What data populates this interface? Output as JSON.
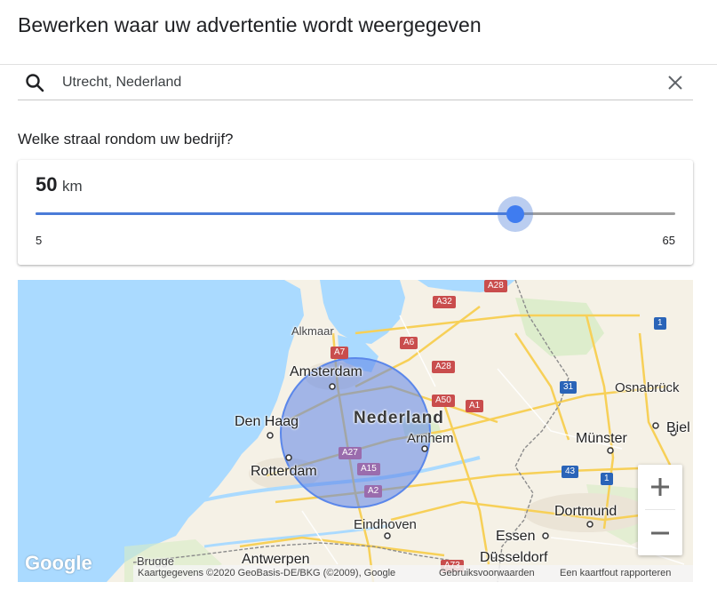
{
  "title": "Bewerken waar uw advertentie wordt weergegeven",
  "search": {
    "value": "Utrecht, Nederland"
  },
  "radius": {
    "question": "Welke straal rondom uw bedrijf?",
    "value": "50",
    "unit": "km",
    "min": "5",
    "max": "65",
    "current": 50,
    "min_value": 5,
    "max_value": 65
  },
  "colors": {
    "accent": "#4a7bd8",
    "water": "#aadaff",
    "land": "#f5f1e6",
    "radius_fill": "#5d83e8"
  },
  "map": {
    "cities": [
      {
        "name": "Alkmaar"
      },
      {
        "name": "Amsterdam"
      },
      {
        "name": "Den Haag"
      },
      {
        "name": "Nederland"
      },
      {
        "name": "Arnhem"
      },
      {
        "name": "Rotterdam"
      },
      {
        "name": "Osnabrück"
      },
      {
        "name": "Münster"
      },
      {
        "name": "Biel"
      },
      {
        "name": "Eindhoven"
      },
      {
        "name": "Dortmund"
      },
      {
        "name": "Essen"
      },
      {
        "name": "Brugge"
      },
      {
        "name": "Antwerpen"
      },
      {
        "name": "Düsseldorf"
      }
    ],
    "roads": [
      "A28",
      "A32",
      "A7",
      "A6",
      "A28",
      "A50",
      "A1",
      "A27",
      "A15",
      "A2",
      "A73",
      "31",
      "1",
      "43",
      "1"
    ],
    "zoom_in": "+",
    "zoom_out": "−",
    "logo": "Google",
    "attribution": {
      "data": "Kaartgegevens ©2020 GeoBasis-DE/BKG (©2009), Google",
      "terms": "Gebruiksvoorwaarden",
      "report": "Een kaartfout rapporteren"
    }
  }
}
